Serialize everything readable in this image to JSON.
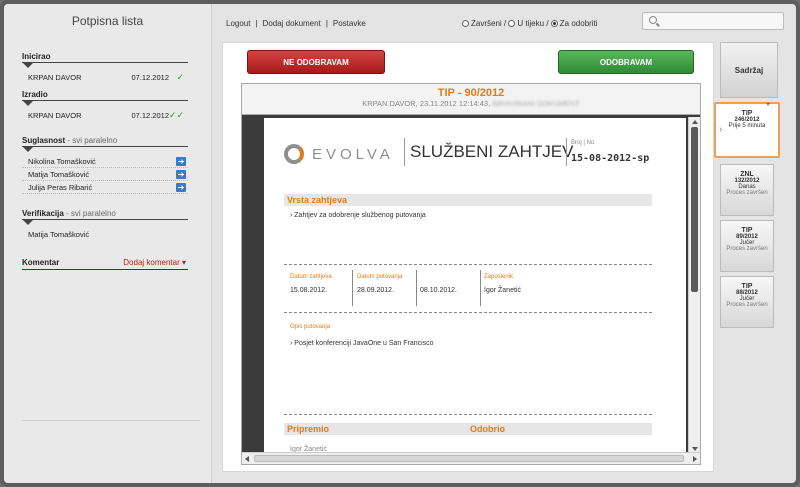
{
  "left": {
    "title": "Potpisna lista",
    "sections": {
      "inicirao": {
        "label": "Inicirao",
        "name": "KRPAN DAVOR",
        "date": "07.12.2012",
        "check": "✓"
      },
      "izradio": {
        "label": "Izradio",
        "name": "KRPAN DAVOR",
        "date": "07.12.2012",
        "check": "✓✓"
      },
      "suglasnost": {
        "label": "Suglasnost",
        "sub": " - svi paralelno",
        "people": [
          "Nikolina Tomašković",
          "Matija Tomašković",
          "Julija Peras Ribarić"
        ]
      },
      "verifikacija": {
        "label": "Verifikacija",
        "sub": " - svi paralelno",
        "name": "Matija Tomašković"
      }
    },
    "komentar": {
      "label": "Komentar",
      "add": "Dodaj komentar ▾"
    }
  },
  "nav": {
    "logout": "Logout",
    "add_doc": "Dodaj dokument",
    "settings": "Postavke",
    "sep": "|",
    "radios": [
      "Završeni",
      "U tijeku",
      "Za odobriti"
    ],
    "radio_sep": "/",
    "selected": "Za odobriti"
  },
  "actions": {
    "reject": "NE ODOBRAVAM",
    "approve": "ODOBRAVAM"
  },
  "doc": {
    "title": "TIP - 90/2012",
    "meta": "KRPAN DAVOR,  23.11.2012 12:14:43,",
    "meta_blurred": "ARHIVIRANI DOKUMENT",
    "logo": "EVOLVA",
    "heading": "SLUŽBENI ZAHTJEV",
    "broj_label": "Broj | No",
    "broj_value": "15-08-2012-sp",
    "vrsta_label": "Vrsta zahtjeva",
    "vrsta_value": "› Zahtjev za odobrenje službenog putovanja",
    "datum_zahtjeva_label": "Datum zahtjeva",
    "datum_zahtjeva": "15.08.2012.",
    "datum_putovanja_label": "Datum putovanja",
    "datum_od": "28.09.2012.",
    "datum_do": "08.10.2012.",
    "zaposlenik_label": "Zaposlenik",
    "zaposlenik": "Igor Žanetić",
    "opis_label": "Opis putovanja",
    "opis_value": "› Posjet konferenciji JavaOne u San Francisco",
    "pripremio": "Pripremio",
    "odobrio": "Odobrio",
    "pripremio_name": "Igor Žanetić"
  },
  "right": {
    "sadrzaj": "Sadržaj",
    "cards": [
      {
        "type": "TIP",
        "code": "246/2012",
        "time": "Prije 5 minuta",
        "active": true
      },
      {
        "type": "ZNL",
        "code": "132/2012",
        "time": "Danas",
        "status": "Proces završen"
      },
      {
        "type": "TIP",
        "code": "89/2012",
        "time": "Jučer",
        "status": "Proces završen"
      },
      {
        "type": "TIP",
        "code": "88/2012",
        "time": "Jučer",
        "status": "Proces završen"
      }
    ]
  }
}
